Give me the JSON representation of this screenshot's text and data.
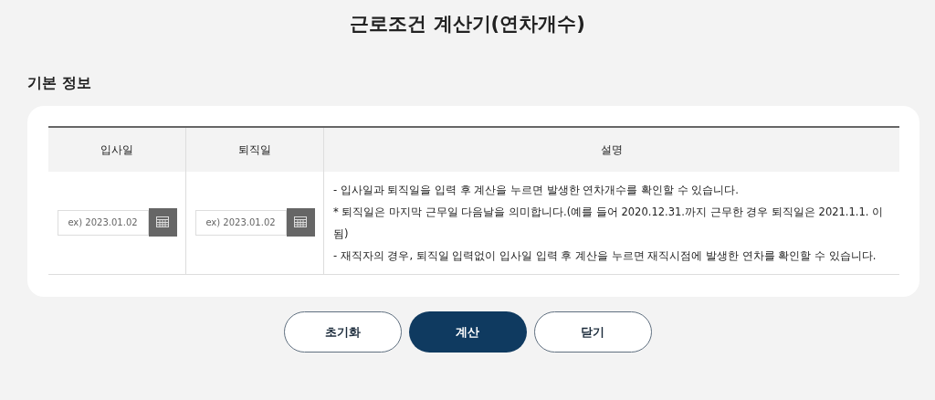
{
  "title": "근로조건 계산기(연차개수)",
  "section": {
    "title": "기본 정보"
  },
  "table": {
    "columns": [
      "입사일",
      "퇴직일",
      "설명"
    ],
    "date_fields": [
      {
        "placeholder": "ex) 2023.01.02"
      },
      {
        "placeholder": "ex) 2023.01.02"
      }
    ],
    "description": [
      "- 입사일과 퇴직일을 입력 후 계산을 누르면 발생한 연차개수를 확인할 수 있습니다.",
      "* 퇴직일은 마지막 근무일 다음날을 의미합니다.(예를 들어 2020.12.31.까지 근무한 경우 퇴직일은 2021.1.1. 이 됨)",
      "- 재직자의 경우, 퇴직일 입력없이 입사일 입력 후 계산을 누르면 재직시점에 발생한 연차를 확인할 수 있습니다."
    ]
  },
  "buttons": [
    {
      "label": "초기화",
      "kind": "outline"
    },
    {
      "label": "계산",
      "kind": "primary"
    },
    {
      "label": "닫기",
      "kind": "outline"
    }
  ]
}
